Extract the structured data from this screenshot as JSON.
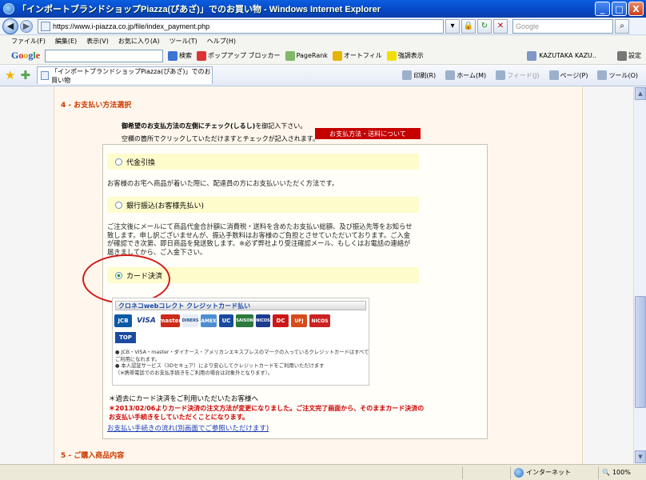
{
  "window": {
    "title": "「インポートブランドショップPiazza(ぴあざ)」でのお買い物 - Windows Internet Explorer",
    "buttons": {
      "minimize": "_",
      "maximize": "□",
      "close": "X"
    }
  },
  "address": {
    "url": "https://www.i-piazza.co.jp/file/index_payment.php",
    "search_placeholder": "Google"
  },
  "menu": [
    "ファイル(F)",
    "編集(E)",
    "表示(V)",
    "お気に入り(A)",
    "ツール(T)",
    "ヘルプ(H)"
  ],
  "google_toolbar": {
    "search_label": "検索",
    "popup_label": "ポップアップ ブロッカー",
    "pagerank_label": "PageRank",
    "autofill_label": "オートフィル",
    "highlight_label": "強調表示",
    "user_label": "KAZUTAKA KAZU..",
    "settings_label": "設定"
  },
  "tab": {
    "title": "「インポートブランドショップPiazza(ぴあざ)」でのお買い物"
  },
  "tab_tools": {
    "print": "印刷(R)",
    "home": "ホーム(M)",
    "feed": "フィード(J)",
    "page": "ページ(P)",
    "tools": "ツール(O)"
  },
  "page": {
    "section4_heading": "4 - お支払い方法選択",
    "instruction_bold": "御希望のお支払方法の左側にチェック(しるし)",
    "instruction_rest": "を御記入下さい。",
    "instruction2": "空欄の箇所でクリックしていただけますとチェックが記入されます。",
    "info_button": "お支払方法・送料について",
    "options": [
      {
        "label": "代金引換",
        "desc": "お客様のお宅へ商品が着いた際に、配達員の方にお支払いいただく方法です。",
        "checked": false
      },
      {
        "label": "銀行振込(お客様先払い)",
        "desc": "ご注文後にメールにて商品代金合計額に消費税・送料を含めたお支払い総額、及び振込先等をお知らせ致します。申し訳ございませんが、振込手数料はお客様のご負担とさせていただいております。ご入金が確認でき次第、即日商品を発送致します。※必ず弊社より受注確認メール、もしくはお電話の連絡が届きましてから、ご入金下さい。",
        "checked": false
      },
      {
        "label": "カード決済",
        "desc": "",
        "checked": true
      }
    ],
    "card_panel": {
      "header": "クロネコwebコレクト クレジットカード払い",
      "logos": [
        "JCB",
        "VISA",
        "master",
        "DINERS",
        "AMEX",
        "UC",
        "SAISON",
        "NICOS",
        "DC",
        "UFJ",
        "NICOS"
      ],
      "top_logo": "TOP",
      "notes": [
        "● JCB・VISA・master・ダイナース・アメリカンエキスプレスのマークの入っているクレジットカードはすべてご利用になれます。",
        "● 本人認証サービス（3Dセキュア）により安心してクレジットカードをご利用いただけます",
        "（※携帯電話でのお支払手続きをご利用の場合は対象外となります）。"
      ]
    },
    "foot1": "＊過去にカード決済をご利用いただいたお客様へ",
    "foot2": "＊2013/02/06よりカード決済の注文方法が変更になりました。ご注文完了画面から、そのままカード決済のお支払い手続きをしていただくことになります。",
    "foot3": "お支払い手続きの流れ(別画面でご参照いただけます)",
    "section5_heading": "5 - ご購入商品内容"
  },
  "status": {
    "zone": "インターネット",
    "zoom": "100%"
  }
}
